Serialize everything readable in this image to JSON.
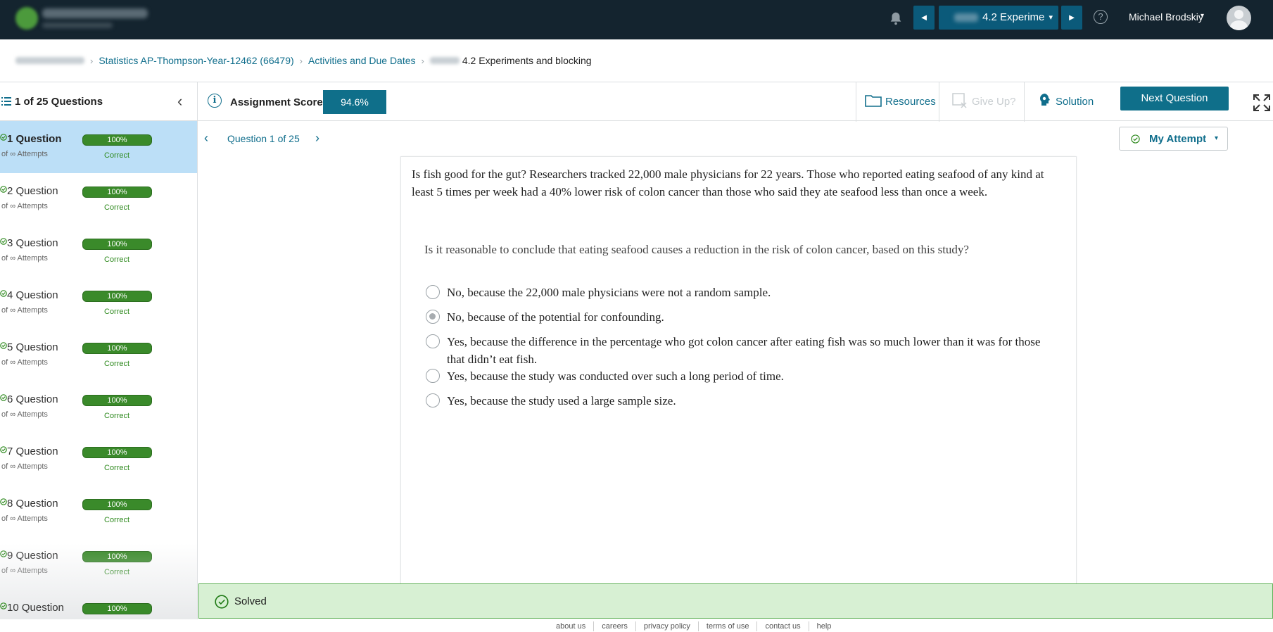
{
  "topbar": {
    "nav_prev": "◄",
    "nav_next": "►",
    "assignment_title": "4.2 Experime",
    "assignment_caret": "▾",
    "help": "?",
    "user_name": "Michael Brodskiy",
    "user_caret": "▾"
  },
  "breadcrumb": {
    "course": "Statistics AP-Thompson-Year-12462 (66479)",
    "section": "Activities and Due Dates",
    "current": "4.2 Experiments and blocking",
    "separator": "›"
  },
  "header": {
    "question_count": "1 of 25 Questions",
    "collapse": "‹",
    "info": "i",
    "score_label": "Assignment Score:",
    "score_value": "94.6%",
    "resources": "Resources",
    "give_up": "Give Up?",
    "solution": "Solution",
    "next_question": "Next Question"
  },
  "sidebar": {
    "items": [
      {
        "name": "1 Question",
        "attempts": "of ∞ Attempts",
        "score": "100%",
        "status": "Correct"
      },
      {
        "name": "2 Question",
        "attempts": "of ∞ Attempts",
        "score": "100%",
        "status": "Correct"
      },
      {
        "name": "3 Question",
        "attempts": "of ∞ Attempts",
        "score": "100%",
        "status": "Correct"
      },
      {
        "name": "4 Question",
        "attempts": "of ∞ Attempts",
        "score": "100%",
        "status": "Correct"
      },
      {
        "name": "5 Question",
        "attempts": "of ∞ Attempts",
        "score": "100%",
        "status": "Correct"
      },
      {
        "name": "6 Question",
        "attempts": "of ∞ Attempts",
        "score": "100%",
        "status": "Correct"
      },
      {
        "name": "7 Question",
        "attempts": "of ∞ Attempts",
        "score": "100%",
        "status": "Correct"
      },
      {
        "name": "8 Question",
        "attempts": "of ∞ Attempts",
        "score": "100%",
        "status": "Correct"
      },
      {
        "name": "9 Question",
        "attempts": "of ∞ Attempts",
        "score": "100%",
        "status": "Correct"
      },
      {
        "name": "10 Question",
        "attempts": "",
        "score": "100%",
        "status": ""
      }
    ]
  },
  "question_nav": {
    "prev": "‹",
    "label": "Question 1 of 25",
    "next": "›",
    "attempt": "My Attempt",
    "attempt_caret": "▾"
  },
  "question": {
    "stem": "Is fish good for the gut? Researchers tracked 22,000 male physicians for 22 years. Those who reported eating seafood of any kind at least 5 times per week had a 40% lower risk of colon cancer than those who said they ate seafood less than once a week.",
    "prompt": "Is it reasonable to conclude that eating seafood causes a reduction in the risk of colon cancer, based on this study?",
    "options": [
      "No, because the 22,000 male physicians were not a random sample.",
      "No, because of the potential for confounding.",
      "Yes, because the difference in the percentage who got colon cancer after eating fish was so much lower than it was for those that didn’t eat fish.",
      "Yes, because the study was conducted over such a long period of time.",
      "Yes, because the study used a large sample size."
    ],
    "selected_option": 1
  },
  "solved": {
    "label": "Solved"
  },
  "footer": {
    "links": [
      "about us",
      "careers",
      "privacy policy",
      "terms of use",
      "contact us",
      "help"
    ]
  },
  "colors": {
    "topbar": "#14242f",
    "accent": "#0f6f8a",
    "link": "#106e8c",
    "success": "#3a8a2a",
    "active_row": "#bcdff7",
    "solved_bg": "#d7f0d3"
  },
  "icons": {
    "bell": "bell-icon",
    "help": "help-icon",
    "info": "info-icon",
    "resources": "folder-icon",
    "give_up": "give-up-icon",
    "solution": "lightbulb-head-icon",
    "expand": "expand-icon",
    "list": "list-icon",
    "check": "check-circle-icon"
  }
}
